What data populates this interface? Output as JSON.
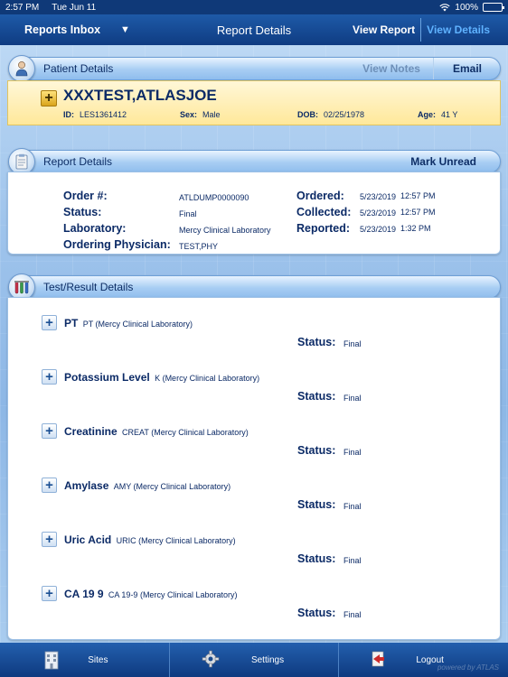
{
  "status_bar": {
    "time": "2:57 PM",
    "date": "Tue Jun 11",
    "battery": "100%"
  },
  "nav": {
    "back_label": "Reports Inbox",
    "title": "Report Details",
    "view_report": "View Report",
    "view_details": "View Details"
  },
  "patient": {
    "header": "Patient Details",
    "view_notes": "View Notes",
    "email": "Email",
    "name": "XXXTEST,ATLASJOE",
    "id_label": "ID:",
    "id": "LES1361412",
    "sex_label": "Sex:",
    "sex": "Male",
    "dob_label": "DOB:",
    "dob": "02/25/1978",
    "age_label": "Age:",
    "age": "41 Y"
  },
  "report": {
    "header": "Report Details",
    "mark_unread": "Mark Unread",
    "order_label": "Order #:",
    "order": "ATLDUMP0000090",
    "status_label": "Status:",
    "status": "Final",
    "lab_label": "Laboratory:",
    "lab": "Mercy Clinical Laboratory",
    "physician_label": "Ordering Physician:",
    "physician": "TEST,PHY",
    "ordered_label": "Ordered:",
    "ordered_date": "5/23/2019",
    "ordered_time": "12:57 PM",
    "collected_label": "Collected:",
    "collected_date": "5/23/2019",
    "collected_time": "12:57 PM",
    "reported_label": "Reported:",
    "reported_date": "5/23/2019",
    "reported_time": "1:32 PM"
  },
  "tests": {
    "header": "Test/Result Details",
    "status_label": "Status:",
    "items": [
      {
        "name": "PT",
        "sub": "PT (Mercy Clinical Laboratory)",
        "status": "Final"
      },
      {
        "name": "Potassium Level",
        "sub": "K (Mercy Clinical Laboratory)",
        "status": "Final"
      },
      {
        "name": "Creatinine",
        "sub": "CREAT (Mercy Clinical Laboratory)",
        "status": "Final"
      },
      {
        "name": "Amylase",
        "sub": "AMY (Mercy Clinical Laboratory)",
        "status": "Final"
      },
      {
        "name": "Uric Acid",
        "sub": "URIC (Mercy Clinical Laboratory)",
        "status": "Final"
      },
      {
        "name": "CA 19  9",
        "sub": "CA 19-9 (Mercy Clinical Laboratory)",
        "status": "Final"
      }
    ]
  },
  "tabbar": {
    "sites": "Sites",
    "settings": "Settings",
    "logout": "Logout",
    "watermark": "powered by ATLAS"
  }
}
